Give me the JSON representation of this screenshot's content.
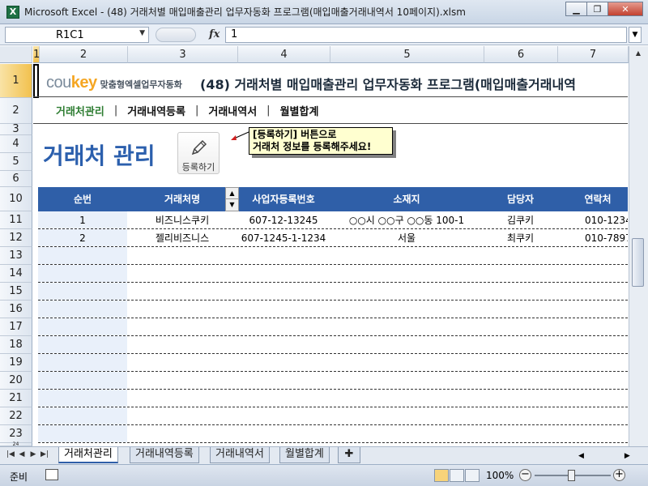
{
  "window": {
    "title": "Microsoft Excel - (48) 거래처별 매입매출관리 업무자동화 프로그램(매입매출거래내역서 10페이지).xlsm",
    "minimize": "▁",
    "restore": "❐",
    "close": "✕"
  },
  "formula_bar": {
    "name_box": "R1C1",
    "fx": "fx",
    "value": "1"
  },
  "columns": [
    "1",
    "2",
    "3",
    "4",
    "5",
    "6",
    "7"
  ],
  "rows": [
    "1",
    "2",
    "3",
    "4",
    "5",
    "6",
    "10",
    "11",
    "12",
    "13",
    "14",
    "15",
    "16",
    "17",
    "18",
    "19",
    "20",
    "21",
    "22",
    "23",
    "24"
  ],
  "sheet": {
    "brand": {
      "logo_a": "cou",
      "logo_b": "key",
      "subtitle": "맞춤형엑셀업무자동화"
    },
    "doc_title": "(48) 거래처별 매입매출관리 업무자동화 프로그램(매입매출거래내역",
    "nav": [
      "거래처관리",
      "거래내역등록",
      "거래내역서",
      "월별합계"
    ],
    "nav_sep": "|",
    "page_title": "거래처 관리",
    "register_button": "등록하기",
    "callout_line1": "[등록하기] 버튼으로",
    "callout_line2": "거래처 정보를 등록해주세요!",
    "table": {
      "headers": [
        "순번",
        "거래처명",
        "사업자등록번호",
        "소재지",
        "담당자",
        "연락처"
      ],
      "rows": [
        [
          "1",
          "비즈니스쿠키",
          "607-12-13245",
          "○○시 ○○구 ○○동 100-1",
          "김쿠키",
          "010-1234"
        ],
        [
          "2",
          "젤리비즈니스",
          "607-1245-1-1234",
          "서울",
          "최쿠키",
          "010-7897"
        ]
      ]
    }
  },
  "sheet_tabs": [
    "거래처관리",
    "거래내역등록",
    "거래내역서",
    "월별합계"
  ],
  "status": {
    "mode": "준비",
    "zoom": "100%"
  },
  "colors": {
    "accent_blue": "#2f5fa8",
    "nav_active": "#2e7d32",
    "callout_bg": "#ffffd0"
  }
}
